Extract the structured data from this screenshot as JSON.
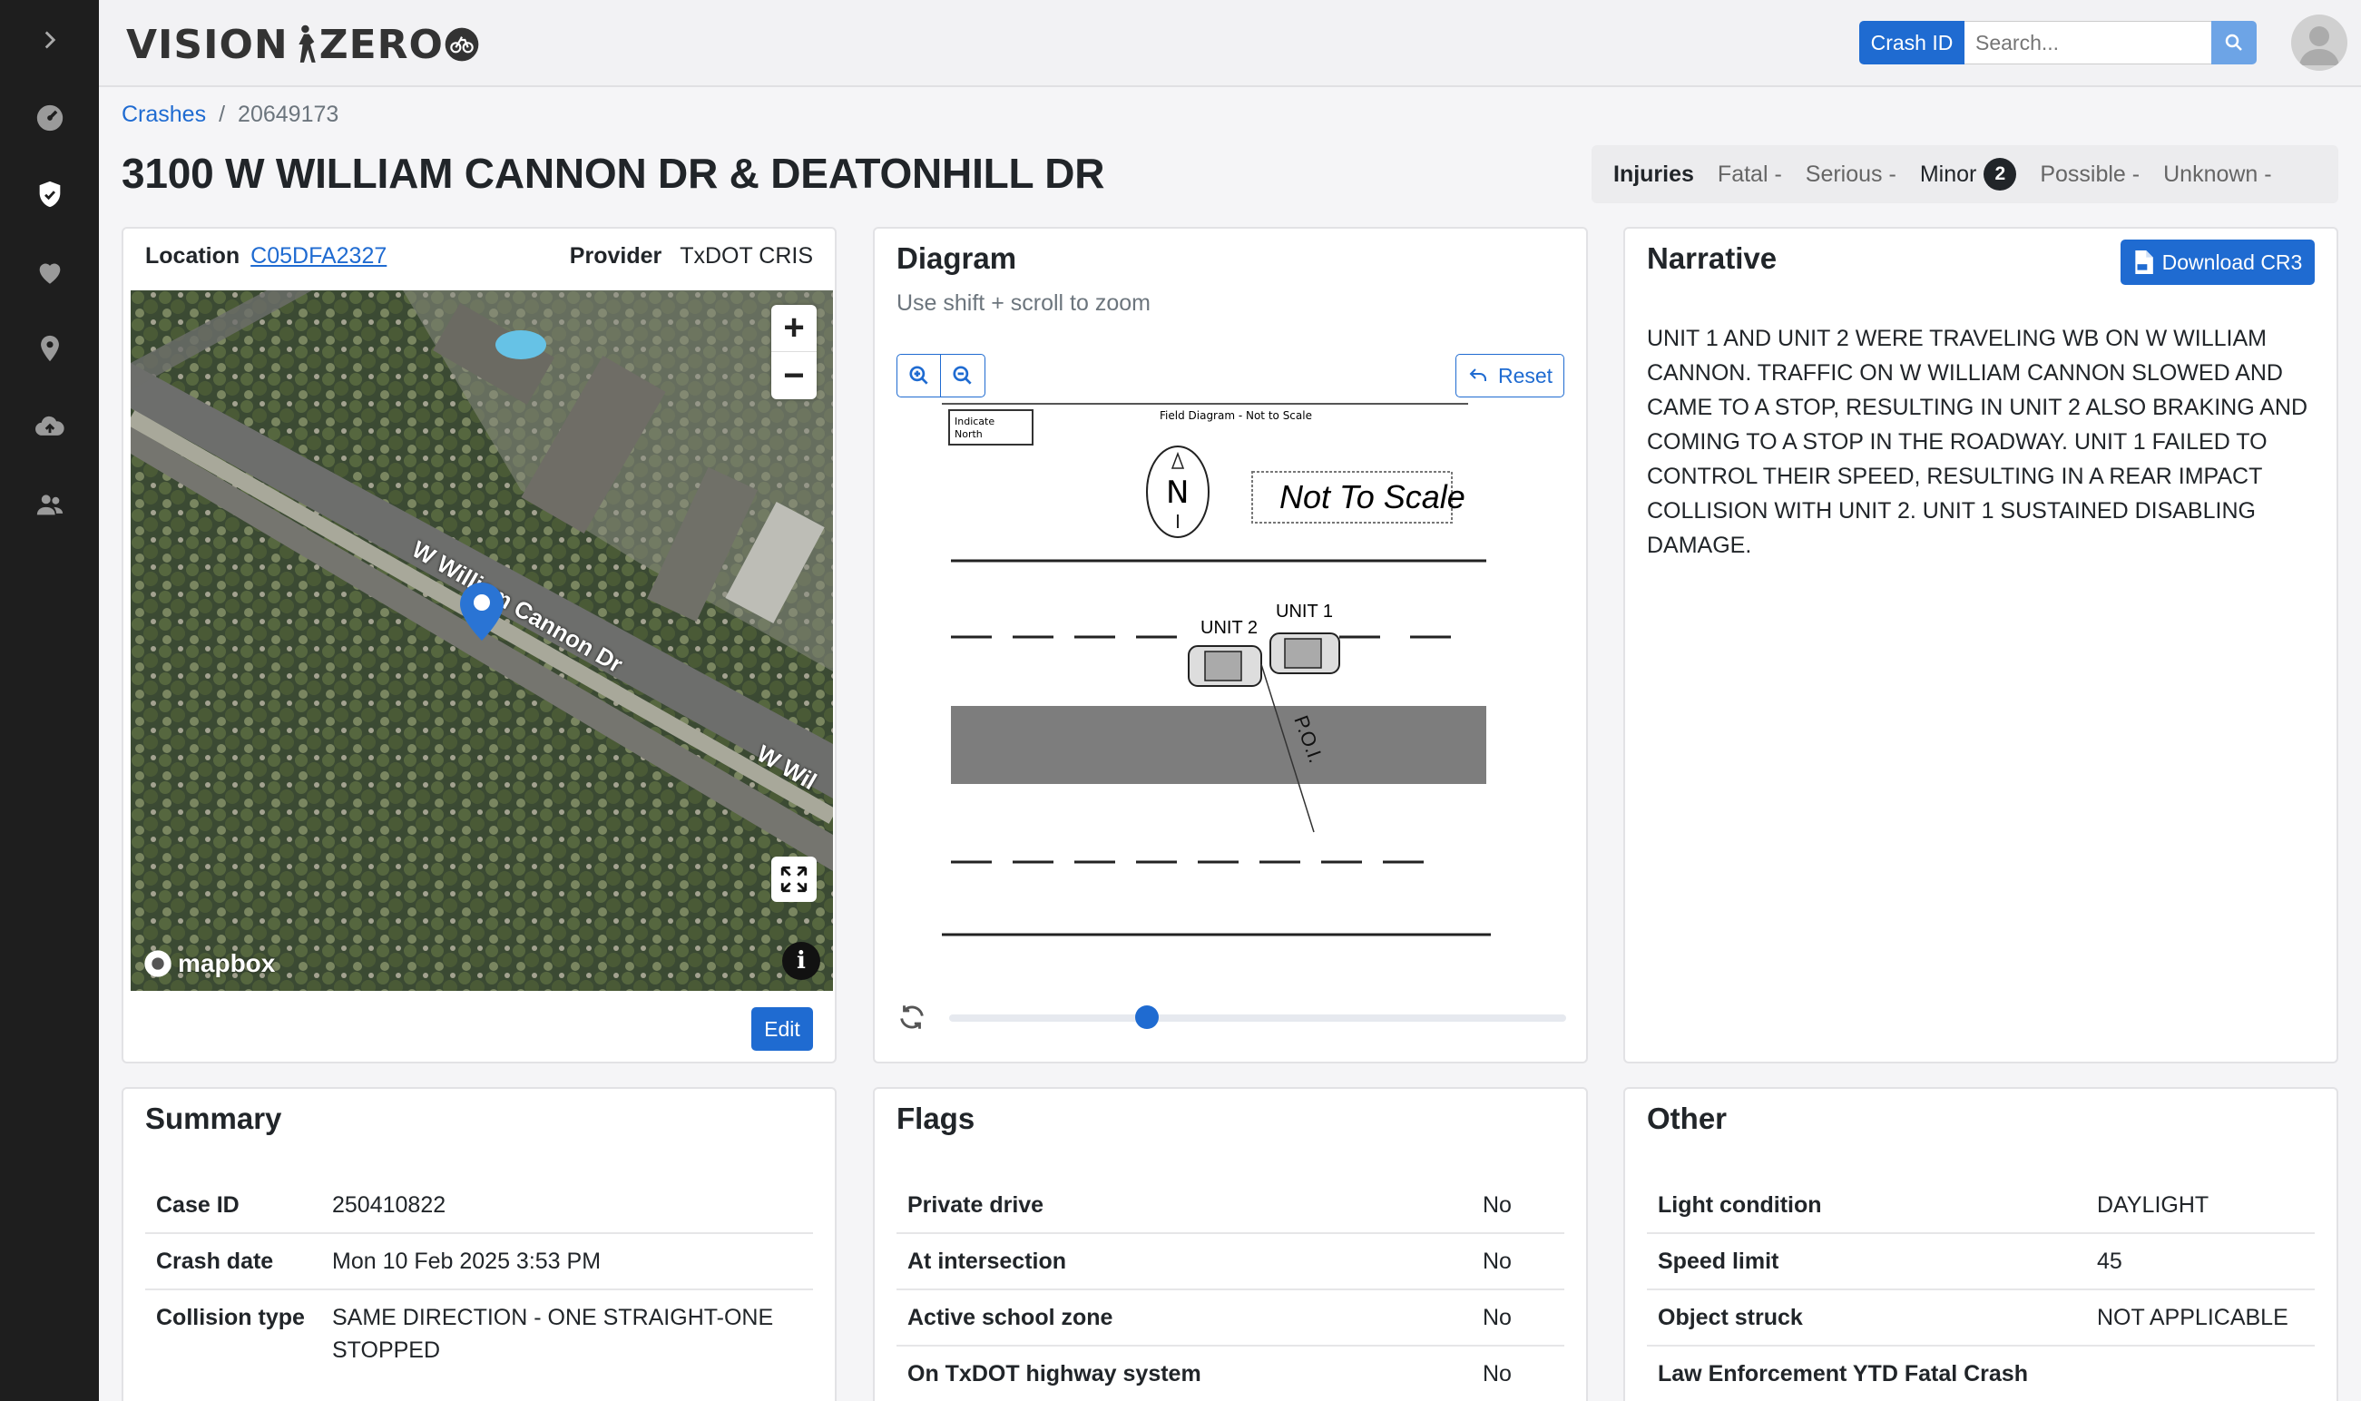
{
  "app": {
    "logo_text_left": "VISION",
    "logo_text_right": "ZERO"
  },
  "sidebar": {
    "items": [
      {
        "icon": "chevron-right-icon"
      },
      {
        "icon": "dashboard-icon"
      },
      {
        "icon": "shield-icon"
      },
      {
        "icon": "heart-icon"
      },
      {
        "icon": "location-pin-icon"
      },
      {
        "icon": "cloud-upload-icon"
      },
      {
        "icon": "users-icon"
      }
    ]
  },
  "header": {
    "search_type_label": "Crash ID",
    "search_placeholder": "Search..."
  },
  "breadcrumb": {
    "root": "Crashes",
    "separator": "/",
    "current": "20649173"
  },
  "page_title": "3100 W WILLIAM CANNON DR & DEATONHILL DR",
  "injuries": {
    "label": "Injuries",
    "fatal": "Fatal -",
    "serious": "Serious -",
    "minor": "Minor",
    "minor_count": "2",
    "possible": "Possible -",
    "unknown": "Unknown -"
  },
  "location_card": {
    "location_label": "Location",
    "location_value": "C05DFA2327",
    "provider_label": "Provider",
    "provider_value": "TxDOT CRIS",
    "map_zoom_in": "+",
    "map_zoom_out": "−",
    "map_street_label": "W William Cannon Dr",
    "map_street_label_2": "W Wil",
    "mapbox_text": "mapbox",
    "info_glyph": "i",
    "edit_label": "Edit"
  },
  "diagram_card": {
    "title": "Diagram",
    "hint": "Use shift + scroll to zoom",
    "reset_label": "Reset",
    "slider_value": 0.32,
    "diagram_text": {
      "header": "Field Diagram - Not to Scale",
      "indicate": "Indicate",
      "north": "North",
      "north_letter": "N",
      "not_to_scale": "Not To Scale",
      "unit1": "UNIT 1",
      "unit2": "UNIT 2",
      "poi": "P.O.I."
    }
  },
  "narrative_card": {
    "title": "Narrative",
    "download_label": "Download CR3",
    "text": "UNIT 1 AND UNIT 2 WERE TRAVELING WB ON W WILLIAM CANNON. TRAFFIC ON W WILLIAM CANNON SLOWED AND CAME TO A STOP, RESULTING IN UNIT 2 ALSO BRAKING AND COMING TO A STOP IN THE ROADWAY. UNIT 1 FAILED TO CONTROL THEIR SPEED, RESULTING IN A REAR IMPACT COLLISION WITH UNIT 2. UNIT 1 SUSTAINED DISABLING DAMAGE."
  },
  "summary_card": {
    "title": "Summary",
    "rows": [
      {
        "label": "Case ID",
        "value": "250410822"
      },
      {
        "label": "Crash date",
        "value": "Mon 10 Feb 2025 3:53 PM"
      },
      {
        "label": "Collision type",
        "value": "SAME DIRECTION - ONE STRAIGHT-ONE STOPPED"
      }
    ]
  },
  "flags_card": {
    "title": "Flags",
    "rows": [
      {
        "label": "Private drive",
        "value": "No"
      },
      {
        "label": "At intersection",
        "value": "No"
      },
      {
        "label": "Active school zone",
        "value": "No"
      },
      {
        "label": "On TxDOT highway system",
        "value": "No"
      }
    ]
  },
  "other_card": {
    "title": "Other",
    "rows": [
      {
        "label": "Light condition",
        "value": "DAYLIGHT"
      },
      {
        "label": "Speed limit",
        "value": "45"
      },
      {
        "label": "Object struck",
        "value": "NOT APPLICABLE"
      },
      {
        "label": "Law Enforcement YTD Fatal Crash",
        "value": ""
      }
    ]
  },
  "colors": {
    "primary": "#1f6bd1",
    "sidebar": "#1e1e1e",
    "badge": "#212529"
  }
}
